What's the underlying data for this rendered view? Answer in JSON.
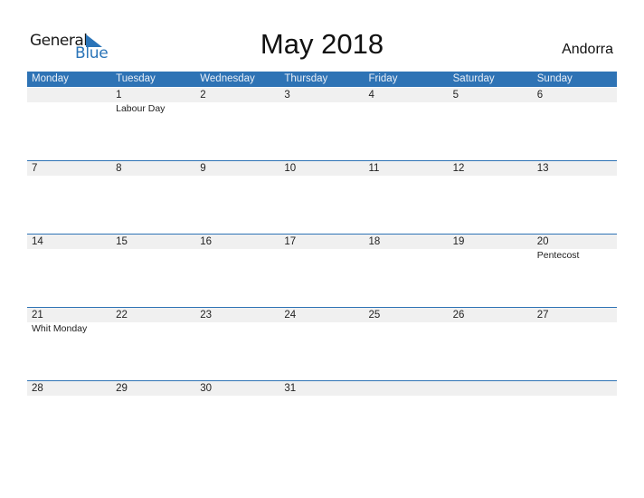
{
  "logo": {
    "word1": "General",
    "word2": "Blue",
    "brand_color": "#2a74b8"
  },
  "title": "May 2018",
  "country": "Andorra",
  "colors": {
    "header_bg": "#2e73b5",
    "date_band": "#f0f0f0"
  },
  "weekdays": [
    "Monday",
    "Tuesday",
    "Wednesday",
    "Thursday",
    "Friday",
    "Saturday",
    "Sunday"
  ],
  "weeks": [
    {
      "days": [
        {
          "num": "",
          "holiday": ""
        },
        {
          "num": "1",
          "holiday": "Labour Day"
        },
        {
          "num": "2",
          "holiday": ""
        },
        {
          "num": "3",
          "holiday": ""
        },
        {
          "num": "4",
          "holiday": ""
        },
        {
          "num": "5",
          "holiday": ""
        },
        {
          "num": "6",
          "holiday": ""
        }
      ]
    },
    {
      "days": [
        {
          "num": "7",
          "holiday": ""
        },
        {
          "num": "8",
          "holiday": ""
        },
        {
          "num": "9",
          "holiday": ""
        },
        {
          "num": "10",
          "holiday": ""
        },
        {
          "num": "11",
          "holiday": ""
        },
        {
          "num": "12",
          "holiday": ""
        },
        {
          "num": "13",
          "holiday": ""
        }
      ]
    },
    {
      "days": [
        {
          "num": "14",
          "holiday": ""
        },
        {
          "num": "15",
          "holiday": ""
        },
        {
          "num": "16",
          "holiday": ""
        },
        {
          "num": "17",
          "holiday": ""
        },
        {
          "num": "18",
          "holiday": ""
        },
        {
          "num": "19",
          "holiday": ""
        },
        {
          "num": "20",
          "holiday": "Pentecost"
        }
      ]
    },
    {
      "days": [
        {
          "num": "21",
          "holiday": "Whit Monday"
        },
        {
          "num": "22",
          "holiday": ""
        },
        {
          "num": "23",
          "holiday": ""
        },
        {
          "num": "24",
          "holiday": ""
        },
        {
          "num": "25",
          "holiday": ""
        },
        {
          "num": "26",
          "holiday": ""
        },
        {
          "num": "27",
          "holiday": ""
        }
      ]
    },
    {
      "days": [
        {
          "num": "28",
          "holiday": ""
        },
        {
          "num": "29",
          "holiday": ""
        },
        {
          "num": "30",
          "holiday": ""
        },
        {
          "num": "31",
          "holiday": ""
        },
        {
          "num": "",
          "holiday": ""
        },
        {
          "num": "",
          "holiday": ""
        },
        {
          "num": "",
          "holiday": ""
        }
      ]
    }
  ]
}
